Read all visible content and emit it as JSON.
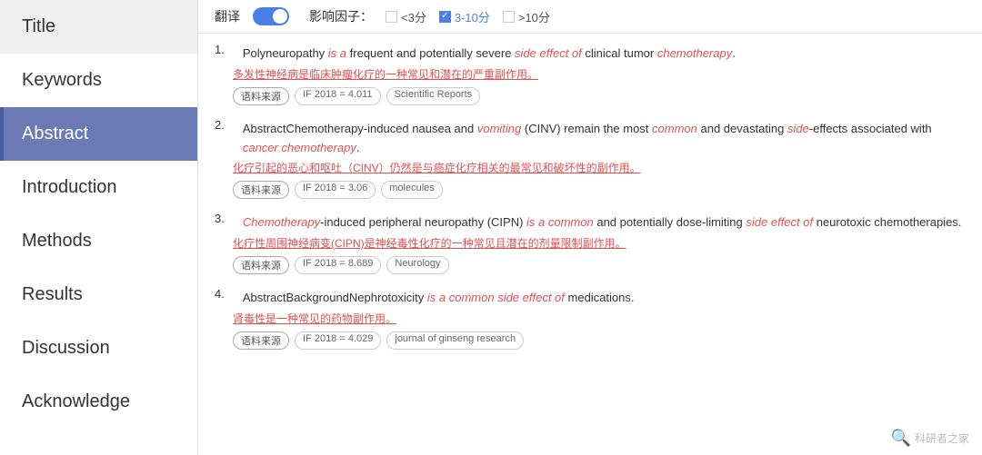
{
  "sidebar": {
    "items": [
      {
        "label": "Title",
        "active": false
      },
      {
        "label": "Keywords",
        "active": false
      },
      {
        "label": "Abstract",
        "active": true
      },
      {
        "label": "Introduction",
        "active": false
      },
      {
        "label": "Methods",
        "active": false
      },
      {
        "label": "Results",
        "active": false
      },
      {
        "label": "Discussion",
        "active": false
      },
      {
        "label": "Acknowledge",
        "active": false
      }
    ]
  },
  "toolbar": {
    "translate_label": "翻译",
    "toggle_on": true,
    "filter_label": "影响因子：",
    "filter_lt3": "<3分",
    "filter_3to10": "3-10分",
    "filter_3to10_checked": true,
    "filter_gt10": ">10分"
  },
  "entries": [
    {
      "number": "1.",
      "text_parts": [
        {
          "text": "Polyneuropathy ",
          "style": "normal"
        },
        {
          "text": "is a",
          "style": "italic-red"
        },
        {
          "text": " frequent and potentially severe ",
          "style": "normal"
        },
        {
          "text": "side effect of",
          "style": "italic-red"
        },
        {
          "text": " clinical tumor ",
          "style": "normal"
        },
        {
          "text": "chemotherapy",
          "style": "italic-red"
        },
        {
          "text": ".",
          "style": "normal"
        }
      ],
      "translation": "多发性神经病是临床肿瘤化疗的一种常见和潜在的严重副作用。",
      "source_tag": "语料来源",
      "if_tag": "IF 2018 = 4.011",
      "journal_tag": "Scientific Reports"
    },
    {
      "number": "2.",
      "text_parts": [
        {
          "text": "AbstractChemotherapy-induced nausea and ",
          "style": "normal"
        },
        {
          "text": "vomiting",
          "style": "italic-red"
        },
        {
          "text": " (CINV) remain the most ",
          "style": "normal"
        },
        {
          "text": "common",
          "style": "italic-red"
        },
        {
          "text": " and devastating ",
          "style": "normal"
        },
        {
          "text": "side",
          "style": "italic-red"
        },
        {
          "text": "-effects associated with ",
          "style": "normal"
        },
        {
          "text": "cancer chemotherapy",
          "style": "italic-red"
        },
        {
          "text": ".",
          "style": "normal"
        }
      ],
      "translation": "化疗引起的恶心和呕吐（CINV）仍然是与癌症化疗相关的最常见和破坏性的副作用。",
      "source_tag": "语料来源",
      "if_tag": "IF 2018 = 3.06",
      "journal_tag": "molecules"
    },
    {
      "number": "3.",
      "text_parts": [
        {
          "text": "Chemotherapy",
          "style": "italic-red"
        },
        {
          "text": "-induced peripheral neuropathy (CIPN) ",
          "style": "normal"
        },
        {
          "text": "is a common",
          "style": "italic-red"
        },
        {
          "text": " and potentially dose-limiting ",
          "style": "normal"
        },
        {
          "text": "side effect of",
          "style": "italic-red"
        },
        {
          "text": " neurotoxic chemotherapies.",
          "style": "normal"
        }
      ],
      "translation": "化疗性周围神经病变(CIPN)是神经毒性化疗的一种常见且潜在的剂量限制副作用。",
      "source_tag": "语料来源",
      "if_tag": "IF 2018 = 8.689",
      "journal_tag": "Neurology"
    },
    {
      "number": "4.",
      "text_parts": [
        {
          "text": "AbstractBackgroundNephrotoxicity ",
          "style": "normal"
        },
        {
          "text": "is a common side effect of",
          "style": "italic-red"
        },
        {
          "text": " medications.",
          "style": "normal"
        }
      ],
      "translation": "肾毒性是一种常见的药物副作用。",
      "source_tag": "语料来源",
      "if_tag": "IF 2018 = 4.029",
      "journal_tag": "journal of ginseng research"
    }
  ],
  "watermark": {
    "icon": "🔍",
    "text": "科研者之家"
  }
}
